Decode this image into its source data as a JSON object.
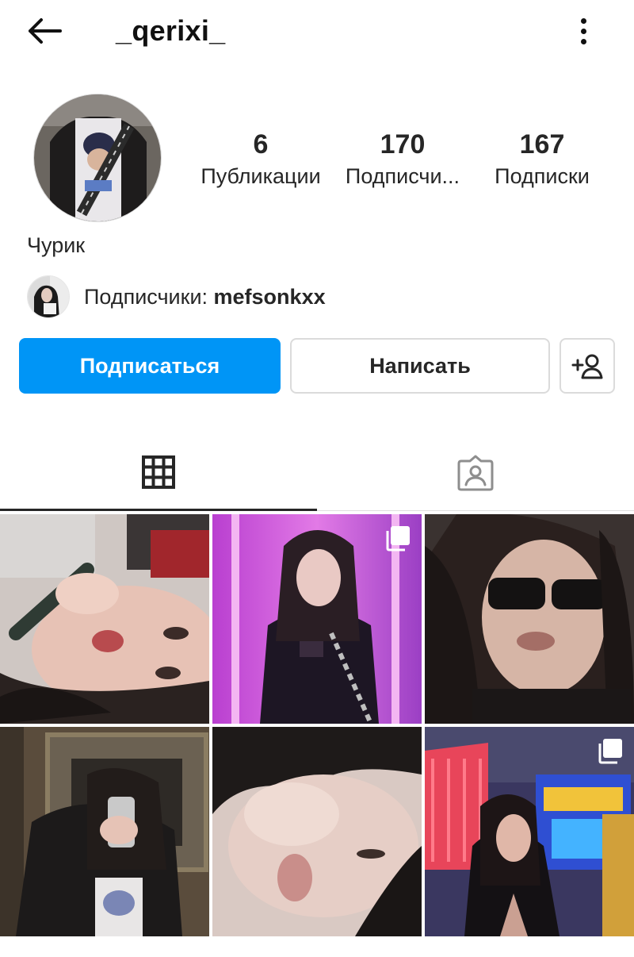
{
  "header": {
    "username": "_qerixi_",
    "back_icon": "arrow-left-icon",
    "more_icon": "more-vertical-icon"
  },
  "profile": {
    "display_name": "Чурик",
    "stats": {
      "posts_count": "6",
      "posts_label": "Публикации",
      "followers_count": "170",
      "followers_label": "Подписчи...",
      "following_count": "167",
      "following_label": "Подписки"
    },
    "followed_by_prefix": "Подписчики: ",
    "followed_by_user": "mefsonkxx"
  },
  "actions": {
    "follow_label": "Подписаться",
    "message_label": "Написать",
    "suggest_icon": "add-user-icon"
  },
  "tabs": {
    "grid_icon": "grid-icon",
    "tagged_icon": "tagged-person-icon"
  },
  "colors": {
    "accent": "#0095f6",
    "text": "#262626",
    "border": "#dbdbdb"
  },
  "posts": [
    {
      "multiple": false
    },
    {
      "multiple": true
    },
    {
      "multiple": false
    },
    {
      "multiple": false
    },
    {
      "multiple": false
    },
    {
      "multiple": true
    }
  ]
}
